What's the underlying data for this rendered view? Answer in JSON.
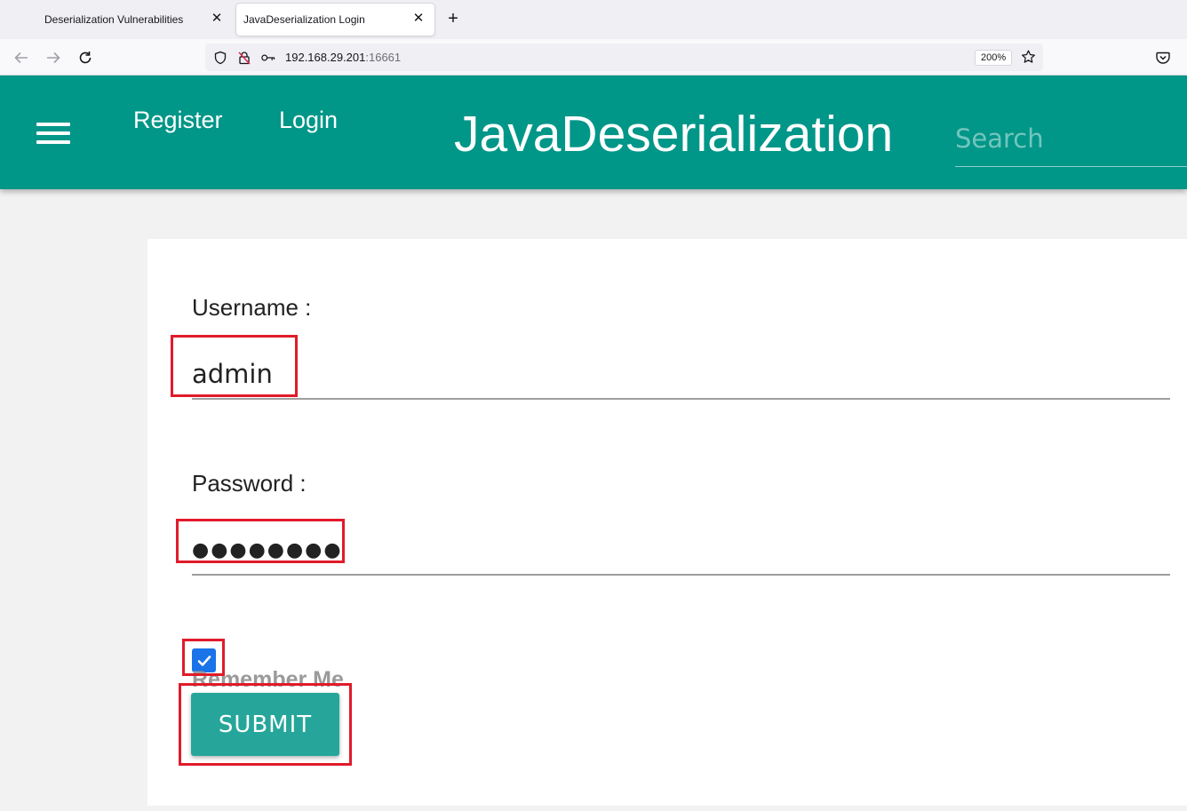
{
  "browser": {
    "tabs": [
      {
        "title": "Deserialization Vulnerabilities",
        "active": false
      },
      {
        "title": "JavaDeserialization Login",
        "active": true
      }
    ],
    "tab_close_glyph": "✕",
    "new_tab_glyph": "+",
    "url_host": "192.168.29.201",
    "url_port": ":16661",
    "zoom": "200%"
  },
  "header": {
    "links": [
      "Register",
      "Login"
    ],
    "brand": "JavaDeserialization",
    "search_placeholder": "Search"
  },
  "form": {
    "username_label": "Username :",
    "username_value": "admin",
    "password_label": "Password :",
    "password_value": "●●●●●●●●",
    "remember_label": "Remember Me",
    "remember_checked": true,
    "submit_label": "SUBMIT"
  },
  "colors": {
    "accent": "#009688",
    "button": "#26a69a",
    "checkbox": "#1a73e8",
    "highlight": "#e01b2a"
  }
}
